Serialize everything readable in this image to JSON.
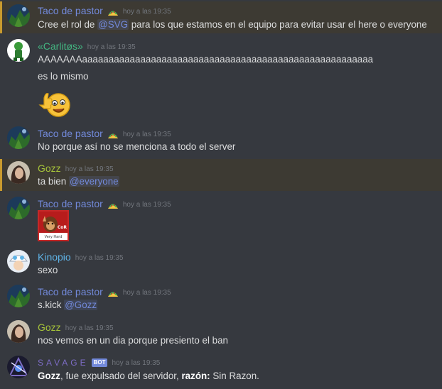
{
  "messages": [
    {
      "author": "Taco de pastor",
      "author_color": "#7289da",
      "timestamp": "hoy a las 19:35",
      "emoji": "taco-icon",
      "highlighted": true,
      "text_prefix": "Cree el rol de ",
      "mention": "@SVG",
      "text_suffix": " para los que estamos en el equipo para evitar usar el here o everyone"
    },
    {
      "author": "«Carlitøs»",
      "author_color": "#43b581",
      "timestamp": "hoy a las 19:35",
      "lines": [
        "AAAAAAAaaaaaaaaaaaaaaaaaaaaaaaaaaaaaaaaaaaaaaaaaaaaaaaaaaaaaaa",
        "es lo mismo"
      ],
      "sticker": "thumbs-up-smiley-emoji"
    },
    {
      "author": "Taco de pastor",
      "author_color": "#7289da",
      "timestamp": "hoy a las 19:35",
      "emoji": "taco-icon",
      "text": "No porque así no se menciona a todo el server"
    },
    {
      "author": "Gozz",
      "author_color": "#a5c23a",
      "timestamp": "hoy a las 19:35",
      "highlighted": true,
      "text_prefix": "ta bien ",
      "mention": "@everyone"
    },
    {
      "author": "Taco de pastor",
      "author_color": "#7289da",
      "timestamp": "hoy a las 19:35",
      "emoji": "taco-icon",
      "image": "donkey-kong-very-hard-image",
      "image_caption": "Very Hard",
      "image_logo": "CoR"
    },
    {
      "author": "Kinopio",
      "author_color": "#5fb3e6",
      "timestamp": "hoy a las 19:35",
      "text": "sexo"
    },
    {
      "author": "Taco de pastor",
      "author_color": "#7289da",
      "timestamp": "hoy a las 19:35",
      "emoji": "taco-icon",
      "text_prefix": "s.kick ",
      "mention": "@Gozz"
    },
    {
      "author": "Gozz",
      "author_color": "#a5c23a",
      "timestamp": "hoy a las 19:35",
      "text": "nos vemos en un dia porque presiento el ban"
    },
    {
      "author": "SAVAGE",
      "author_color": "#7c6cc4",
      "timestamp": "hoy a las 19:35",
      "badge": "BOT",
      "parts": [
        "Gozz",
        ", fue expulsado del servidor, ",
        "razón:",
        " Sin Razon."
      ]
    }
  ],
  "colors": {
    "background": "#36393f",
    "mention": "#7289da",
    "highlight_border": "#c99a2e"
  }
}
